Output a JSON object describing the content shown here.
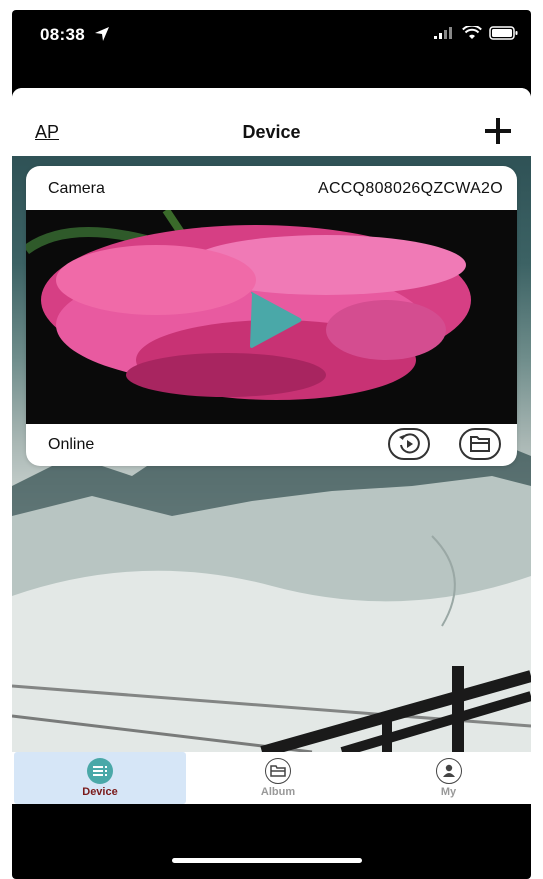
{
  "status_bar": {
    "time": "08:38"
  },
  "nav": {
    "left_label": "AP",
    "title": "Device"
  },
  "device_card": {
    "name": "Camera",
    "device_id": "ACCQ808026QZCWA2O",
    "status": "Online"
  },
  "tabs": [
    {
      "label": "Device",
      "icon": "list-icon",
      "active": true
    },
    {
      "label": "Album",
      "icon": "folder-icon",
      "active": false
    },
    {
      "label": "My",
      "icon": "person-icon",
      "active": false
    }
  ],
  "colors": {
    "accent": "#4aa8a8",
    "active_tab_bg": "#d6e6f7",
    "active_tab_label": "#7a1a1a",
    "inactive": "#999999"
  }
}
